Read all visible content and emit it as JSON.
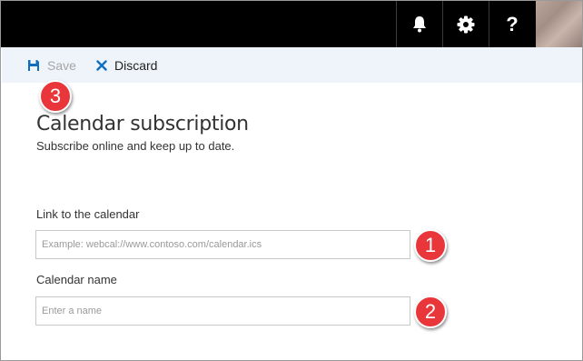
{
  "topbar": {
    "icons": [
      "bell-icon",
      "gear-icon",
      "help-icon"
    ],
    "help_glyph": "?",
    "background": "#000000"
  },
  "commandbar": {
    "save_label": "Save",
    "discard_label": "Discard",
    "save_icon": "floppy-disk-icon",
    "discard_icon": "close-icon",
    "accent": "#106ebe",
    "background": "#eef4fa"
  },
  "form": {
    "title": "Calendar subscription",
    "subtitle": "Subscribe online and keep up to date.",
    "link_label": "Link to the calendar",
    "link_value": "",
    "link_placeholder": "Example: webcal://www.contoso.com/calendar.ics",
    "name_label": "Calendar name",
    "name_value": "",
    "name_placeholder": "Enter a name"
  },
  "callouts": {
    "one": "1",
    "two": "2",
    "three": "3",
    "color": "#e8363b"
  }
}
